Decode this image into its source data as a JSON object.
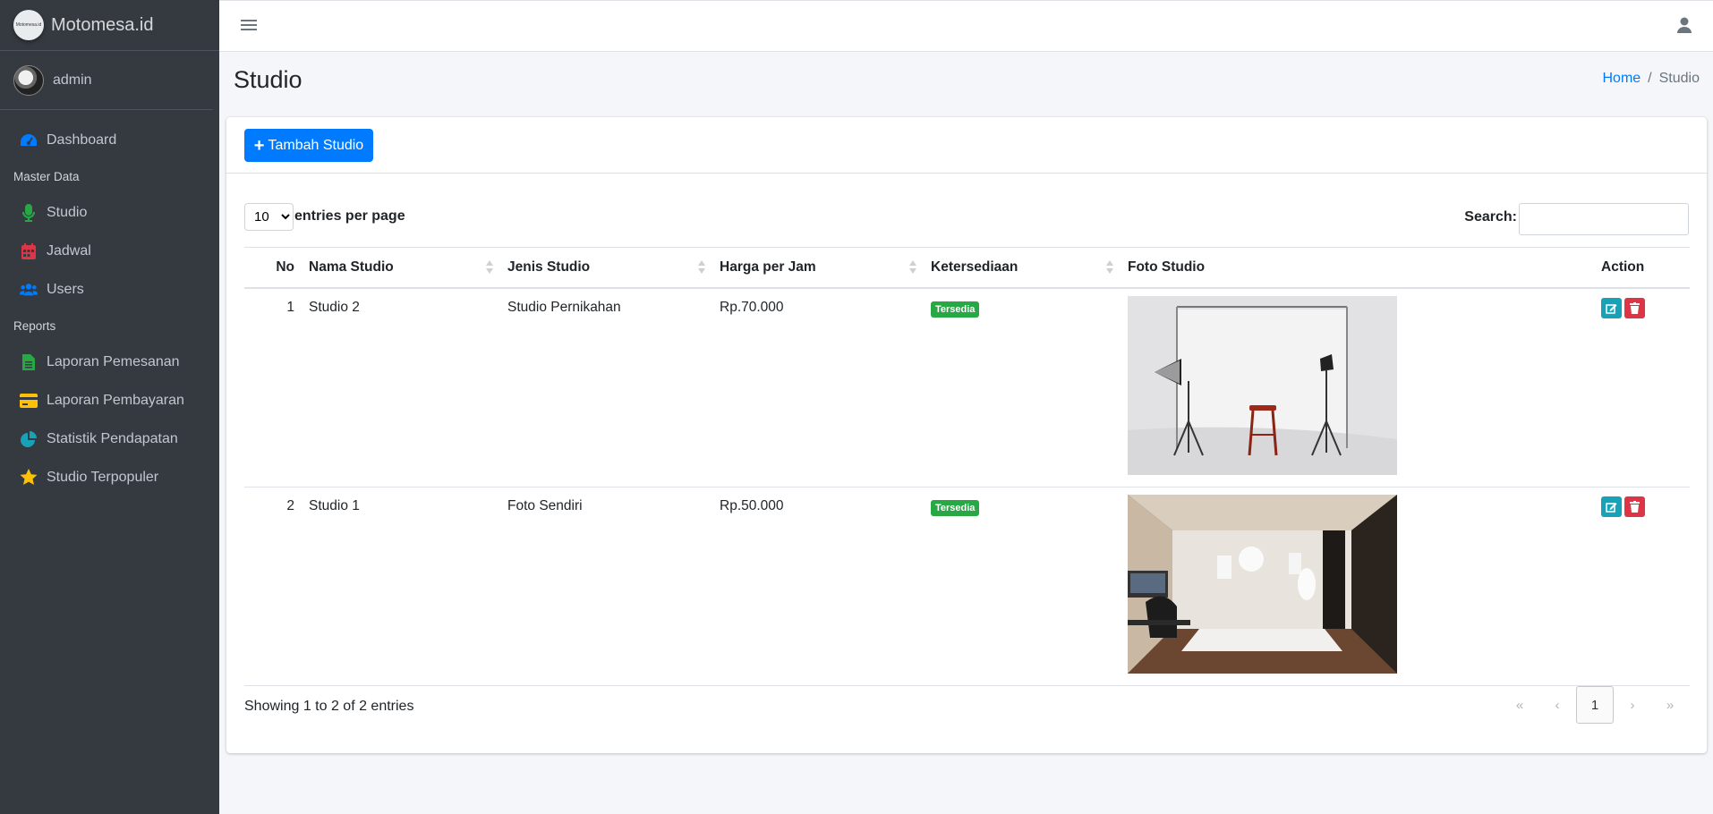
{
  "brand": {
    "name": "Motomesa.id",
    "logo_text": "Motomesa.id"
  },
  "user": {
    "name": "admin"
  },
  "sidebar": {
    "items": [
      {
        "label": "Dashboard",
        "icon": "tachometer-icon",
        "color": "#007bff"
      },
      {
        "header": "Master Data"
      },
      {
        "label": "Studio",
        "icon": "microphone-icon",
        "color": "#28a745"
      },
      {
        "label": "Jadwal",
        "icon": "calendar-icon",
        "color": "#dc3545"
      },
      {
        "label": "Users",
        "icon": "users-icon",
        "color": "#007bff"
      },
      {
        "header": "Reports"
      },
      {
        "label": "Laporan Pemesanan",
        "icon": "file-icon",
        "color": "#28a745"
      },
      {
        "label": "Laporan Pembayaran",
        "icon": "credit-card-icon",
        "color": "#ffc107"
      },
      {
        "label": "Statistik Pendapatan",
        "icon": "pie-chart-icon",
        "color": "#17a2b8"
      },
      {
        "label": "Studio Terpopuler",
        "icon": "star-icon",
        "color": "#ffc107"
      }
    ]
  },
  "header": {
    "title": "Studio",
    "breadcrumb": [
      "Home",
      "Studio"
    ]
  },
  "toolbar": {
    "add_label": "Tambah Studio"
  },
  "table_controls": {
    "entries_value": "10",
    "entries_label": "entries per page",
    "search_label": "Search:",
    "search_value": ""
  },
  "table": {
    "columns": [
      "No",
      "Nama Studio",
      "Jenis Studio",
      "Harga per Jam",
      "Ketersediaan",
      "Foto Studio",
      "Action"
    ],
    "rows": [
      {
        "no": "1",
        "nama": "Studio 2",
        "jenis": "Studio Pernikahan",
        "harga": "Rp.70.000",
        "status": "Tersedia"
      },
      {
        "no": "2",
        "nama": "Studio 1",
        "jenis": "Foto Sendiri",
        "harga": "Rp.50.000",
        "status": "Tersedia"
      }
    ]
  },
  "footer": {
    "info": "Showing 1 to 2 of 2 entries",
    "pages": [
      "«",
      "‹",
      "1",
      "›",
      "»"
    ],
    "current_page": "1"
  },
  "colors": {
    "primary": "#007bff",
    "success": "#28a745",
    "info": "#17a2b8",
    "danger": "#dc3545",
    "sidebar": "#343a40"
  }
}
